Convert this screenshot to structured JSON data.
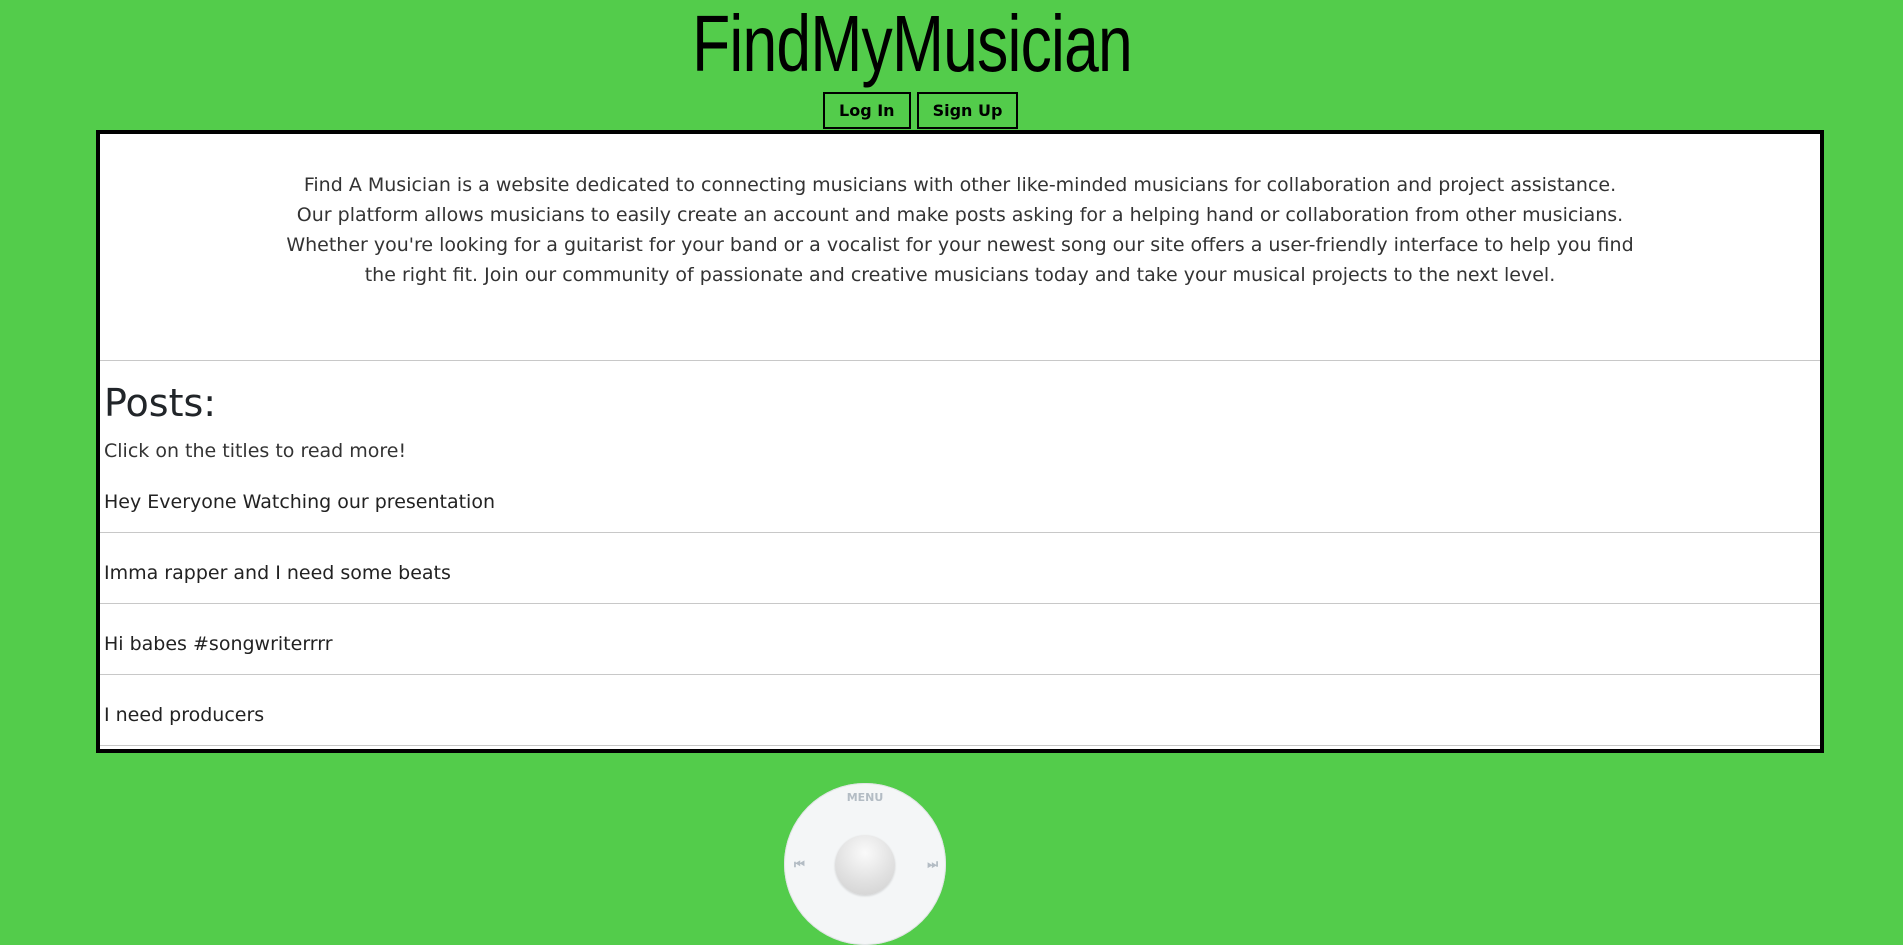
{
  "header": {
    "title": "FindMyMusician",
    "login_label": "Log In",
    "signup_label": "Sign Up"
  },
  "intro": {
    "lines": [
      "Find A Musician is a website dedicated to connecting musicians with other like-minded musicians for collaboration and project assistance.",
      "Our platform allows musicians to easily create an account and make posts asking for a helping hand or collaboration from other musicians.",
      "Whether you're looking for a guitarist for your band or a vocalist for your newest song our site offers a user-friendly interface to help you find",
      "the right fit. Join our community of passionate and creative musicians today and take your musical projects to the next level."
    ]
  },
  "posts": {
    "heading": "Posts:",
    "hint": "Click on the titles to read more!",
    "items": [
      {
        "title": "Hey Everyone Watching our presentation"
      },
      {
        "title": "Imma rapper and I need some beats"
      },
      {
        "title": "Hi babes #songwriterrrr"
      },
      {
        "title": "I need producers"
      }
    ]
  },
  "wheel": {
    "menu_label": "MENU",
    "prev_icon": "⏮",
    "next_icon": "⏭",
    "icons": [
      "previous-track-icon",
      "next-track-icon"
    ]
  },
  "colors": {
    "background": "#53CC4B",
    "panel": "#FFFFFF",
    "border": "#000000"
  }
}
